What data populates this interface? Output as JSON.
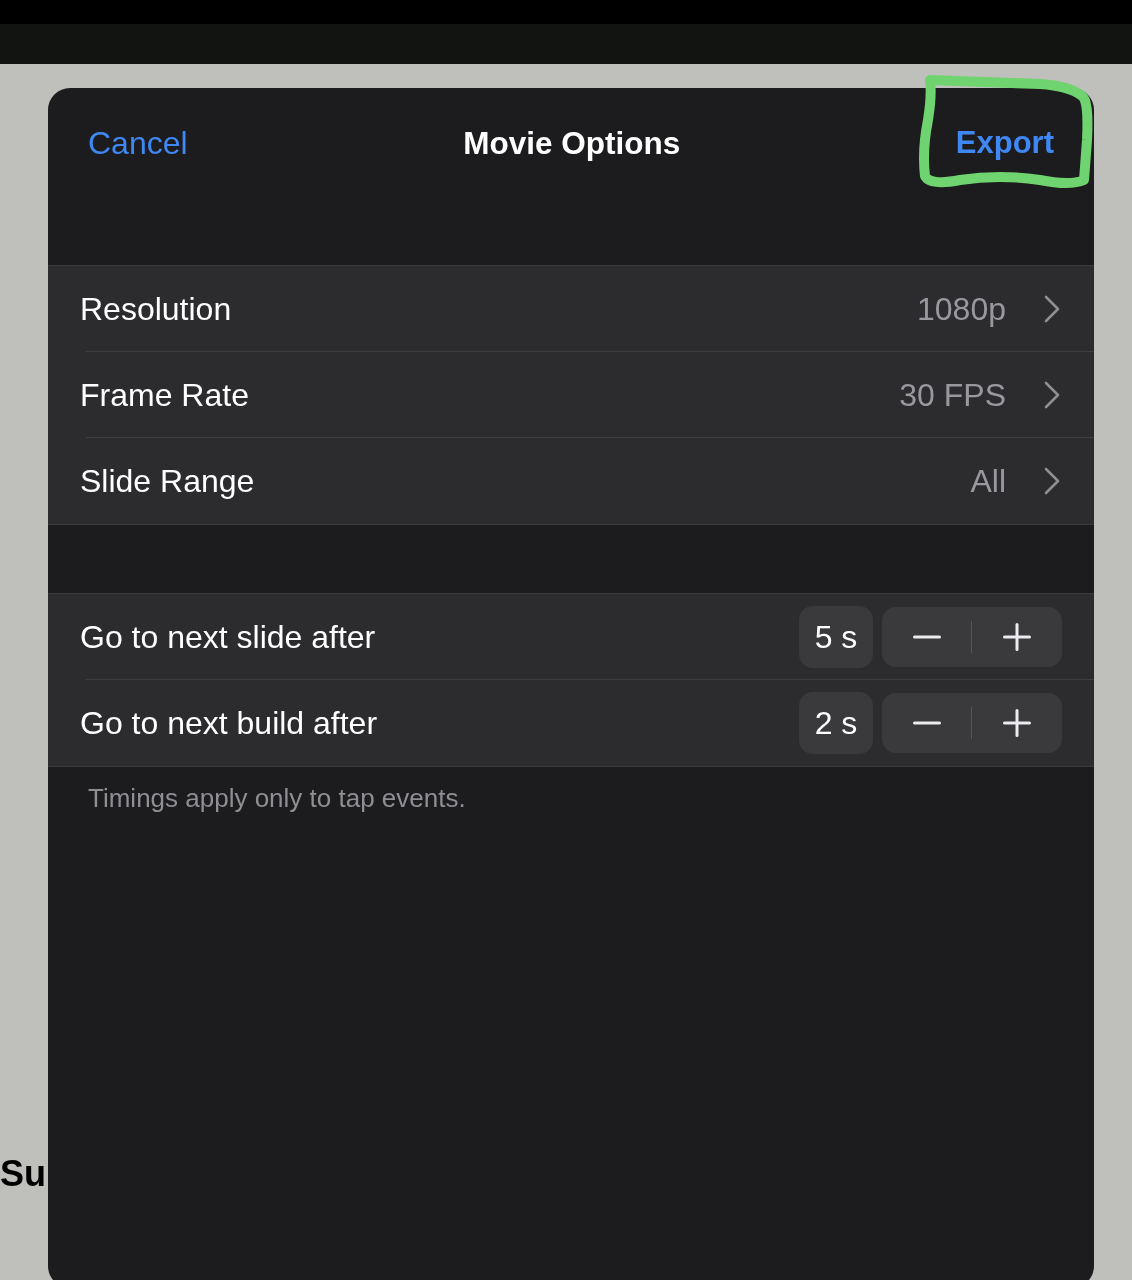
{
  "background": {
    "text": "Su"
  },
  "sheet": {
    "title": "Movie Options",
    "cancel_button": {
      "label": "Cancel"
    },
    "export_button": {
      "label": "Export",
      "highlighted": true
    }
  },
  "option_rows": [
    {
      "label": "Resolution",
      "value": "1080p"
    },
    {
      "label": "Frame Rate",
      "value": "30 FPS"
    },
    {
      "label": "Slide Range",
      "value": "All"
    }
  ],
  "timing_rows": [
    {
      "label": "Go to next slide after",
      "value": "5 s"
    },
    {
      "label": "Go to next build after",
      "value": "2 s"
    }
  ],
  "footnote": "Timings apply only to tap events."
}
